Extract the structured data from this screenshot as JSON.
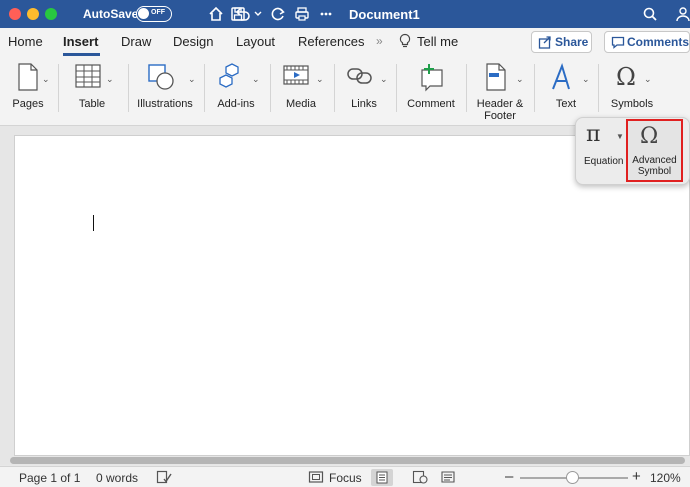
{
  "titlebar": {
    "autosave_label": "AutoSave",
    "autosave_state": "OFF",
    "document_title": "Document1"
  },
  "tabs": [
    {
      "label": "Home",
      "active": false
    },
    {
      "label": "Insert",
      "active": true
    },
    {
      "label": "Draw",
      "active": false
    },
    {
      "label": "Design",
      "active": false
    },
    {
      "label": "Layout",
      "active": false
    },
    {
      "label": "References",
      "active": false
    }
  ],
  "tellme": {
    "label": "Tell me"
  },
  "share": {
    "label": "Share"
  },
  "comments": {
    "label": "Comments"
  },
  "ribbon": {
    "groups": [
      {
        "label": "Pages",
        "icon": "pages-icon"
      },
      {
        "label": "Table",
        "icon": "table-icon"
      },
      {
        "label": "Illustrations",
        "icon": "illustrations-icon"
      },
      {
        "label": "Add-ins",
        "icon": "add-ins-icon"
      },
      {
        "label": "Media",
        "icon": "media-icon"
      },
      {
        "label": "Links",
        "icon": "links-icon"
      },
      {
        "label": "Comment",
        "icon": "comment-icon"
      },
      {
        "label": "Header &",
        "label2": "Footer",
        "icon": "header-footer-icon"
      },
      {
        "label": "Text",
        "icon": "text-icon"
      },
      {
        "label": "Symbols",
        "icon": "omega-icon"
      }
    ]
  },
  "symbols_popup": {
    "equation_symbol": "π",
    "equation_label": "Equation",
    "advanced_symbol_glyph": "Ω",
    "advanced_label_line1": "Advanced",
    "advanced_label_line2": "Symbol"
  },
  "ribbon_symbols_glyph": "Ω",
  "statusbar": {
    "page": "Page 1 of 1",
    "words": "0 words",
    "focus": "Focus",
    "zoom": "120%",
    "zoom_minus": "–",
    "zoom_plus": "+"
  },
  "colors": {
    "titlebar": "#2b579a",
    "highlight_border": "#e02020"
  }
}
